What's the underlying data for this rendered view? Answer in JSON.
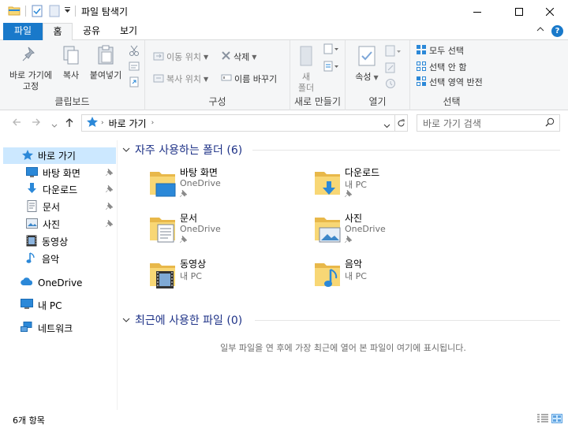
{
  "window": {
    "title": "파일 탐색기",
    "minimize_icon": "minimize-icon",
    "maximize_icon": "maximize-icon",
    "close_icon": "close-icon"
  },
  "ribbon_tabs": [
    "파일",
    "홈",
    "공유",
    "보기"
  ],
  "ribbon": {
    "clipboard": {
      "label": "클립보드",
      "pin_label_1": "바로 가기에",
      "pin_label_2": "고정",
      "copy": "복사",
      "paste": "붙여넣기"
    },
    "organize": {
      "label": "구성",
      "move_to": "이동 위치",
      "copy_to": "복사 위치",
      "delete": "삭제",
      "rename": "이름 바꾸기"
    },
    "new": {
      "label": "새로 만들기",
      "new_folder_1": "새",
      "new_folder_2": "폴더"
    },
    "open": {
      "label": "열기",
      "properties": "속성"
    },
    "select": {
      "label": "선택",
      "select_all": "모두 선택",
      "select_none": "선택 안 함",
      "invert": "선택 영역 반전"
    }
  },
  "address": {
    "path_root": "바로 가기",
    "search_placeholder": "바로 가기 검색"
  },
  "nav_pane": {
    "quick_access": "바로 가기",
    "items": [
      "바탕 화면",
      "다운로드",
      "문서",
      "사진",
      "동영상",
      "음악"
    ],
    "onedrive": "OneDrive",
    "this_pc": "내 PC",
    "network": "네트워크"
  },
  "content": {
    "frequent_header": "자주 사용하는 폴더 (6)",
    "recent_header": "최근에 사용한 파일 (0)",
    "empty_message": "일부 파일을 연 후에 가장 최근에 열어 본 파일이 여기에 표시됩니다.",
    "folders": [
      {
        "name": "바탕 화면",
        "location": "OneDrive",
        "pinned": true
      },
      {
        "name": "다운로드",
        "location": "내 PC",
        "pinned": true
      },
      {
        "name": "문서",
        "location": "OneDrive",
        "pinned": true
      },
      {
        "name": "사진",
        "location": "OneDrive",
        "pinned": true
      },
      {
        "name": "동영상",
        "location": "내 PC",
        "pinned": false
      },
      {
        "name": "음악",
        "location": "내 PC",
        "pinned": false
      }
    ]
  },
  "status": {
    "item_count": "6개 항목"
  },
  "colors": {
    "accent": "#1979ca",
    "section_header": "#1e3287",
    "selection": "#cce8ff",
    "folder": "#f8d775"
  }
}
